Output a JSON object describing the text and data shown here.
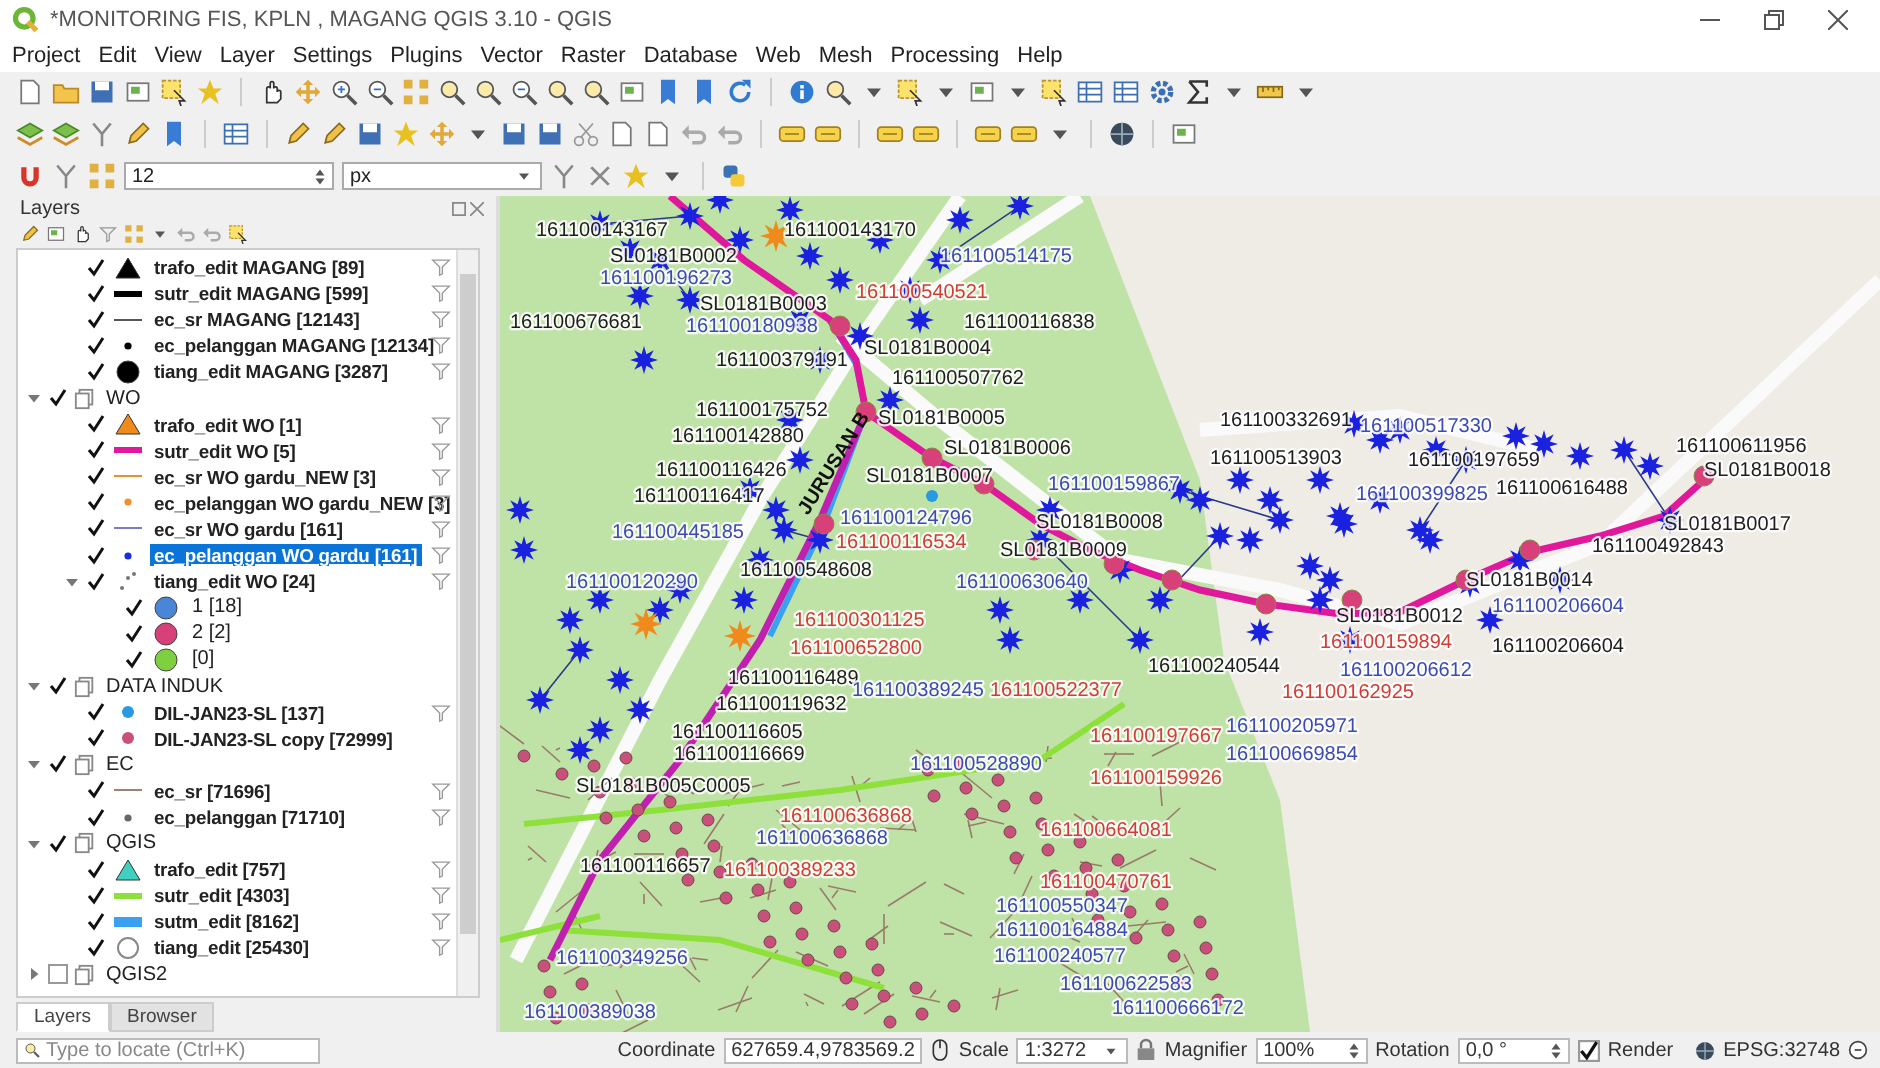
{
  "window": {
    "title": "*MONITORING FIS, KPLN , MAGANG QGIS 3.10 - QGIS"
  },
  "menu": [
    "Project",
    "Edit",
    "View",
    "Layer",
    "Settings",
    "Plugins",
    "Vector",
    "Raster",
    "Database",
    "Web",
    "Mesh",
    "Processing",
    "Help"
  ],
  "snapping_toolbar": {
    "tolerance": "12",
    "unit": "px"
  },
  "layers_panel": {
    "title": "Layers",
    "tree": [
      {
        "kind": "group",
        "children": [
          {
            "kind": "triangle",
            "label": "trafo_edit MAGANG [89]",
            "checked": true,
            "color": "#000000",
            "filter": true,
            "selected": false
          },
          {
            "kind": "thick-line",
            "label": "sutr_edit MAGANG [599]",
            "checked": true,
            "color": "#000000",
            "filter": true,
            "selected": false
          },
          {
            "kind": "thin-line",
            "label": "ec_sr MAGANG [12143]",
            "checked": true,
            "color": "#555555",
            "filter": true,
            "selected": false
          },
          {
            "kind": "small-dot",
            "label": "ec_pelanggan MAGANG [12134]",
            "checked": true,
            "color": "#000000",
            "filter": true,
            "selected": false
          },
          {
            "kind": "circle",
            "label": "tiang_edit MAGANG [3287]",
            "checked": true,
            "color": "#000000",
            "filter": true,
            "selected": false
          }
        ]
      },
      {
        "kind": "group",
        "label": "WO",
        "checked": true,
        "expanded": true,
        "selected": false,
        "children": [
          {
            "kind": "triangle",
            "label": "trafo_edit WO [1]",
            "checked": true,
            "color": "#f08a1c",
            "filter": true,
            "selected": false
          },
          {
            "kind": "thick-line",
            "label": "sutr_edit WO [5]",
            "checked": true,
            "color": "#e0189c",
            "filter": true,
            "selected": false
          },
          {
            "kind": "thin-line",
            "label": "ec_sr WO gardu_NEW [3]",
            "checked": true,
            "color": "#e8902c",
            "filter": true,
            "selected": false
          },
          {
            "kind": "small-dot",
            "label": "ec_pelanggan WO gardu_NEW [3]",
            "checked": true,
            "color": "#f0902c",
            "filter": true,
            "selected": false
          },
          {
            "kind": "thin-line",
            "label": "ec_sr WO gardu [161]",
            "checked": true,
            "color": "#7b7bd0",
            "filter": true,
            "selected": false
          },
          {
            "kind": "small-dot",
            "label": "ec_pelanggan WO gardu [161]",
            "checked": true,
            "color": "#1a2ee0",
            "filter": true,
            "selected": true
          },
          {
            "kind": "points",
            "label": "tiang_edit WO [24]",
            "checked": true,
            "expanded": true,
            "color": "#777777",
            "filter": true,
            "selected": false,
            "children": [
              {
                "kind": "circle",
                "label": "1 [18]",
                "checked": true,
                "color": "#4a86d8",
                "selected": false
              },
              {
                "kind": "circle",
                "label": "2 [2]",
                "checked": true,
                "color": "#d8407a",
                "selected": false
              },
              {
                "kind": "circle",
                "label": "[0]",
                "checked": true,
                "color": "#7ed040",
                "selected": false
              }
            ]
          }
        ]
      },
      {
        "kind": "group",
        "label": "DATA INDUK",
        "checked": true,
        "expanded": true,
        "selected": false,
        "children": [
          {
            "kind": "dot",
            "label": "DIL-JAN23-SL [137]",
            "checked": true,
            "color": "#2a9ae0",
            "filter": true,
            "selected": false
          },
          {
            "kind": "dot",
            "label": "DIL-JAN23-SL copy [72999]",
            "checked": true,
            "color": "#c8507a",
            "filter": false,
            "selected": false
          }
        ]
      },
      {
        "kind": "group",
        "label": "EC",
        "checked": true,
        "expanded": true,
        "selected": false,
        "children": [
          {
            "kind": "thin-line",
            "label": "ec_sr [71696]",
            "checked": true,
            "color": "#a08070",
            "filter": true,
            "selected": false
          },
          {
            "kind": "small-dot",
            "label": "ec_pelanggan [71710]",
            "checked": true,
            "color": "#666666",
            "filter": true,
            "selected": false
          }
        ]
      },
      {
        "kind": "group",
        "label": "QGIS",
        "checked": true,
        "expanded": true,
        "selected": false,
        "children": [
          {
            "kind": "triangle",
            "label": "trafo_edit [757]",
            "checked": true,
            "color": "#40d0c0",
            "filter": true,
            "selected": false
          },
          {
            "kind": "thick-line",
            "label": "sutr_edit [4303]",
            "checked": true,
            "color": "#8ee03a",
            "filter": true,
            "selected": false
          },
          {
            "kind": "bar",
            "label": "sutm_edit [8162]",
            "checked": true,
            "color": "#3aa0f0",
            "filter": true,
            "selected": false
          },
          {
            "kind": "ring",
            "label": "tiang_edit [25430]",
            "checked": true,
            "color": "#888888",
            "filter": true,
            "selected": false
          }
        ]
      },
      {
        "kind": "group",
        "label": "QGIS2",
        "checked": false,
        "expanded": false,
        "selected": false
      }
    ],
    "tabs": [
      {
        "label": "Layers",
        "selected": true
      },
      {
        "label": "Browser",
        "selected": false
      }
    ]
  },
  "map": {
    "road_label": "JURUSAN B",
    "labels": [
      {
        "text": "161100143167",
        "color": "#1e1e1e"
      },
      {
        "text": "161100143170",
        "color": "#1e1e1e"
      },
      {
        "text": "SL0181B0002",
        "color": "#1e1e1e"
      },
      {
        "text": "SL0181B0003",
        "color": "#1e1e1e"
      },
      {
        "text": "161100676681",
        "color": "#1e1e1e"
      },
      {
        "text": "161100379191",
        "color": "#1e1e1e"
      },
      {
        "text": "SL0181B0004",
        "color": "#1e1e1e"
      },
      {
        "text": "161100507762",
        "color": "#1e1e1e"
      },
      {
        "text": "161100116838",
        "color": "#1e1e1e"
      },
      {
        "text": "161100175752",
        "color": "#1e1e1e"
      },
      {
        "text": "161100142880",
        "color": "#1e1e1e"
      },
      {
        "text": "SL0181B0005",
        "color": "#1e1e1e"
      },
      {
        "text": "161100116426",
        "color": "#1e1e1e"
      },
      {
        "text": "SL0181B0006",
        "color": "#1e1e1e"
      },
      {
        "text": "161100116417",
        "color": "#1e1e1e"
      },
      {
        "text": "SL0181B0007",
        "color": "#1e1e1e"
      },
      {
        "text": "161100548608",
        "color": "#1e1e1e"
      },
      {
        "text": "SL0181B0008",
        "color": "#1e1e1e"
      },
      {
        "text": "SL0181B0009",
        "color": "#1e1e1e"
      },
      {
        "text": "161100332691",
        "color": "#1e1e1e"
      },
      {
        "text": "161100513903",
        "color": "#1e1e1e"
      },
      {
        "text": "161100197659",
        "color": "#1e1e1e"
      },
      {
        "text": "161100616488",
        "color": "#1e1e1e"
      },
      {
        "text": "161100611956",
        "color": "#1e1e1e"
      },
      {
        "text": "SL0181B0018",
        "color": "#1e1e1e"
      },
      {
        "text": "SL0181B0017",
        "color": "#1e1e1e"
      },
      {
        "text": "161100492843",
        "color": "#1e1e1e"
      },
      {
        "text": "SL0181B0014",
        "color": "#1e1e1e"
      },
      {
        "text": "SL0181B0012",
        "color": "#1e1e1e"
      },
      {
        "text": "161100206604",
        "color": "#1e1e1e"
      },
      {
        "text": "161100240544",
        "color": "#1e1e1e"
      },
      {
        "text": "161100116489",
        "color": "#1e1e1e"
      },
      {
        "text": "161100119632",
        "color": "#1e1e1e"
      },
      {
        "text": "161100116605",
        "color": "#1e1e1e"
      },
      {
        "text": "161100116669",
        "color": "#1e1e1e"
      },
      {
        "text": "SL0181B005C0005",
        "color": "#1e1e1e"
      },
      {
        "text": "161100116657",
        "color": "#1e1e1e"
      },
      {
        "text": "161100514175",
        "color": "#3c4bb4"
      },
      {
        "text": "161100196273",
        "color": "#3c4bb4"
      },
      {
        "text": "161100180938",
        "color": "#3c4bb4"
      },
      {
        "text": "161100445185",
        "color": "#3c4bb4"
      },
      {
        "text": "161100124796",
        "color": "#3c4bb4"
      },
      {
        "text": "161100159867",
        "color": "#3c4bb4"
      },
      {
        "text": "161100120290",
        "color": "#3c4bb4"
      },
      {
        "text": "161100630640",
        "color": "#3c4bb4"
      },
      {
        "text": "161100517330",
        "color": "#3c4bb4"
      },
      {
        "text": "161100399825",
        "color": "#3c4bb4"
      },
      {
        "text": "161100206604",
        "color": "#3c4bb4"
      },
      {
        "text": "161100206612",
        "color": "#3c4bb4"
      },
      {
        "text": "161100205971",
        "color": "#3c4bb4"
      },
      {
        "text": "161100669854",
        "color": "#3c4bb4"
      },
      {
        "text": "161100389245",
        "color": "#3c4bb4"
      },
      {
        "text": "161100528890",
        "color": "#3c4bb4"
      },
      {
        "text": "161100636868",
        "color": "#3c4bb4"
      },
      {
        "text": "161100550347",
        "color": "#3c4bb4"
      },
      {
        "text": "161100164884",
        "color": "#3c4bb4"
      },
      {
        "text": "161100240577",
        "color": "#3c4bb4"
      },
      {
        "text": "161100622583",
        "color": "#3c4bb4"
      },
      {
        "text": "161100666172",
        "color": "#3c4bb4"
      },
      {
        "text": "161100349256",
        "color": "#3c4bb4"
      },
      {
        "text": "161100389038",
        "color": "#3c4bb4"
      },
      {
        "text": "161100540521",
        "color": "#d23c32"
      },
      {
        "text": "161100116534",
        "color": "#d23c32"
      },
      {
        "text": "161100301125",
        "color": "#d23c32"
      },
      {
        "text": "161100652800",
        "color": "#d23c32"
      },
      {
        "text": "161100159894",
        "color": "#d23c32"
      },
      {
        "text": "161100162925",
        "color": "#d23c32"
      },
      {
        "text": "161100159926",
        "color": "#d23c32"
      },
      {
        "text": "161100664081",
        "color": "#d23c32"
      },
      {
        "text": "161100470761",
        "color": "#d23c32"
      },
      {
        "text": "161100389233",
        "color": "#d23c32"
      },
      {
        "text": "161100636868",
        "color": "#d23c32"
      },
      {
        "text": "161100522377",
        "color": "#d23c32"
      },
      {
        "text": "161100197667",
        "color": "#d23c32"
      }
    ]
  },
  "status_bar": {
    "locator_placeholder": "Type to locate (Ctrl+K)",
    "coordinate_label": "Coordinate",
    "coordinate": "627659.4,9783569.2",
    "scale_label": "Scale",
    "scale": "1:3272",
    "magnifier_label": "Magnifier",
    "magnifier": "100%",
    "rotation_label": "Rotation",
    "rotation": "0,0 °",
    "render": {
      "label": "Render",
      "checked": true
    },
    "crs": "EPSG:32748"
  }
}
